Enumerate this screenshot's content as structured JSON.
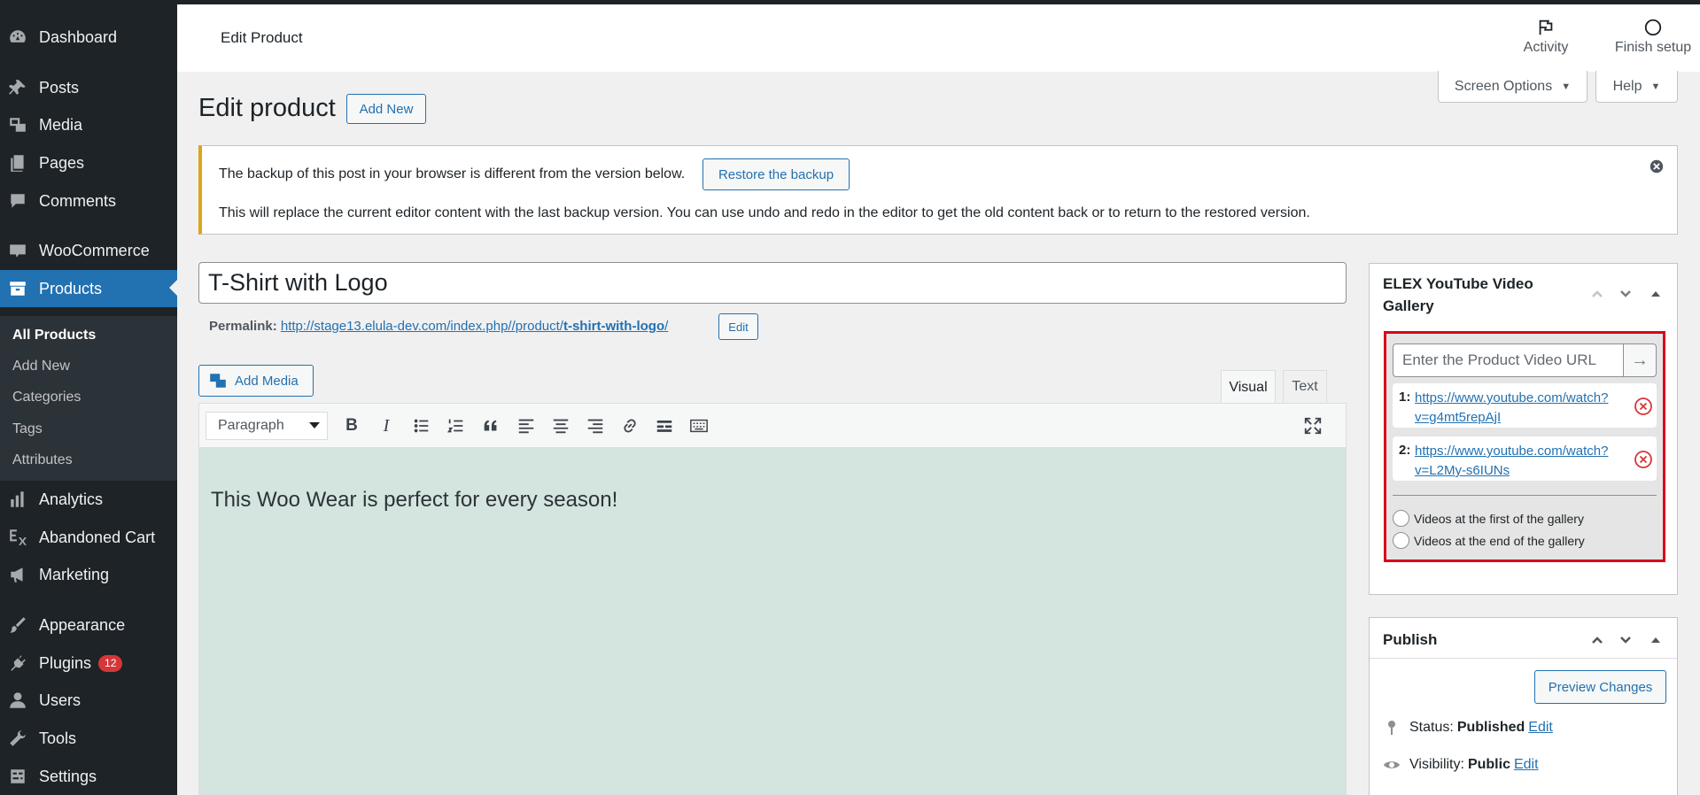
{
  "sidebar": {
    "items": [
      {
        "label": "Dashboard",
        "icon": "dashboard-icon"
      },
      {
        "label": "Posts",
        "icon": "pin-icon"
      },
      {
        "label": "Media",
        "icon": "media-icon"
      },
      {
        "label": "Pages",
        "icon": "pages-icon"
      },
      {
        "label": "Comments",
        "icon": "comment-icon"
      },
      {
        "label": "WooCommerce",
        "icon": "woo-icon"
      },
      {
        "label": "Products",
        "icon": "archive-icon"
      },
      {
        "label": "Analytics",
        "icon": "bar-chart-icon"
      },
      {
        "label": "Abandoned Cart",
        "icon": "elex-icon"
      },
      {
        "label": "Marketing",
        "icon": "megaphone-icon"
      },
      {
        "label": "Appearance",
        "icon": "brush-icon"
      },
      {
        "label": "Plugins",
        "icon": "plugin-icon",
        "badge": "12"
      },
      {
        "label": "Users",
        "icon": "user-icon"
      },
      {
        "label": "Tools",
        "icon": "wrench-icon"
      },
      {
        "label": "Settings",
        "icon": "settings-icon"
      }
    ],
    "submenu": [
      "All Products",
      "Add New",
      "Categories",
      "Tags",
      "Attributes"
    ]
  },
  "header": {
    "title": "Edit Product",
    "activity": "Activity",
    "finish_setup": "Finish setup",
    "screen_options": "Screen Options",
    "help": "Help"
  },
  "page": {
    "title": "Edit product",
    "add_new": "Add New"
  },
  "notice": {
    "line1": "The backup of this post in your browser is different from the version below.",
    "restore_button": "Restore the backup",
    "line2": "This will replace the current editor content with the last backup version. You can use undo and redo in the editor to get the old content back or to return to the restored version."
  },
  "product": {
    "title": "T-Shirt with Logo",
    "permalink_label": "Permalink:",
    "permalink_base": "http://stage13.elula-dev.com/index.php//product/",
    "permalink_slug": "t-shirt-with-logo",
    "permalink_tail": "/",
    "permalink_edit": "Edit"
  },
  "editor": {
    "add_media": "Add Media",
    "tab_visual": "Visual",
    "tab_text": "Text",
    "format": "Paragraph",
    "content": "This Woo Wear is perfect for every season!"
  },
  "elex_box": {
    "title": "ELEX YouTube Video Gallery",
    "placeholder": "Enter the Product Video URL",
    "go_icon": "→",
    "videos": [
      {
        "num": "1:",
        "url": "https://www.youtube.com/watch?v=g4mt5repAjI"
      },
      {
        "num": "2:",
        "url": "https://www.youtube.com/watch?v=L2My-s6IUNs"
      }
    ],
    "opt_first": "Videos at the first of the gallery",
    "opt_end": "Videos at the end of the gallery"
  },
  "publish": {
    "title": "Publish",
    "preview": "Preview Changes",
    "status_label": "Status:",
    "status_value": "Published",
    "visibility_label": "Visibility:",
    "visibility_value": "Public",
    "edit": "Edit"
  },
  "colors": {
    "sidebar_bg": "#1d2327",
    "accent": "#2271b1",
    "editor_bg": "#d3e5de",
    "highlight_border": "#d9001b",
    "notice_warning": "#dba617"
  }
}
